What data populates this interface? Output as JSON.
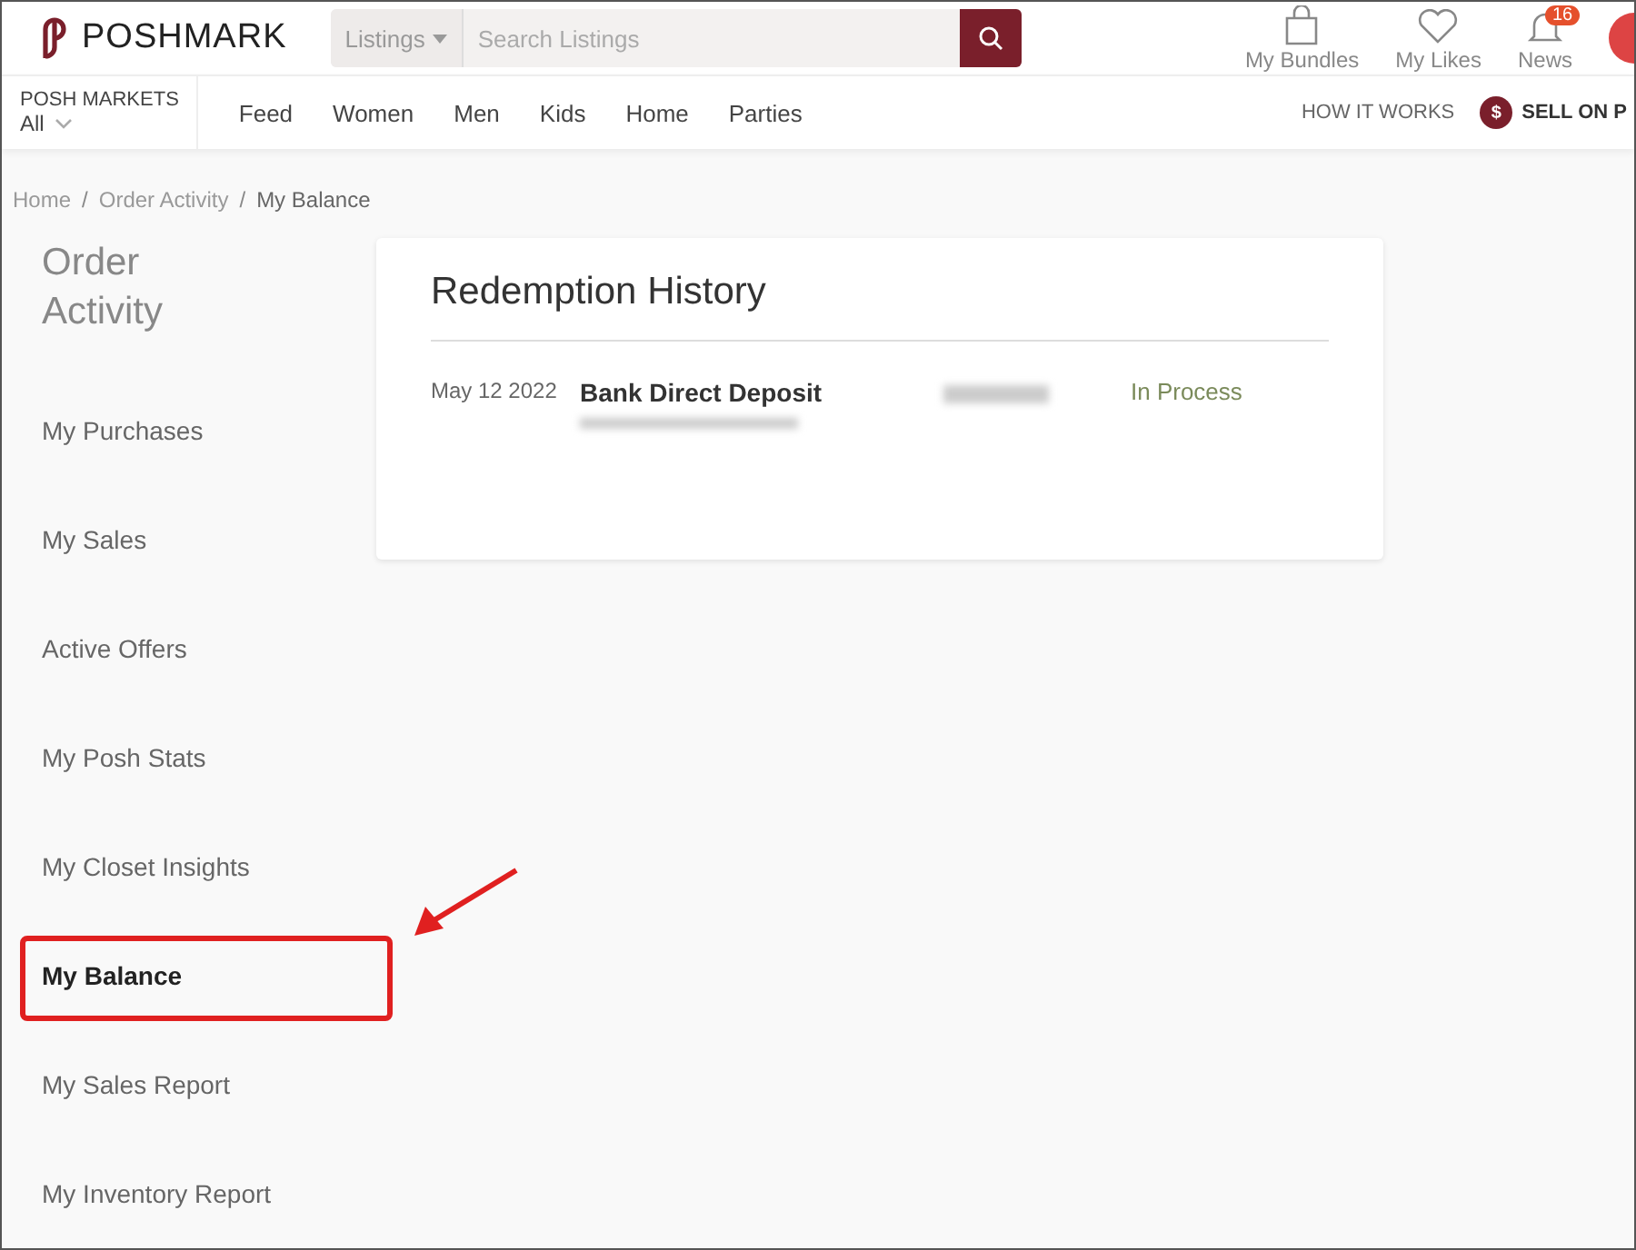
{
  "header": {
    "logo": "POSHMARK",
    "search_scope": "Listings",
    "search_placeholder": "Search Listings",
    "nav_icons": [
      {
        "kind": "bag",
        "label": "My Bundles"
      },
      {
        "kind": "heart",
        "label": "My Likes"
      },
      {
        "kind": "bell",
        "label": "News",
        "badge": "16"
      }
    ]
  },
  "market": {
    "title": "POSH MARKETS",
    "value": "All"
  },
  "categories": [
    "Feed",
    "Women",
    "Men",
    "Kids",
    "Home",
    "Parties"
  ],
  "how_it_works": "HOW IT WORKS",
  "sell_icon": "$",
  "sell": "SELL ON P",
  "breadcrumb_separator": "/",
  "breadcrumb": [
    "Home",
    "Order Activity",
    "My Balance"
  ],
  "sidebar": {
    "title": "Order Activity",
    "items": [
      {
        "label": "My Purchases",
        "selected": false
      },
      {
        "label": "My Sales",
        "selected": false
      },
      {
        "label": "Active Offers",
        "selected": false
      },
      {
        "label": "My Posh Stats",
        "selected": false
      },
      {
        "label": "My Closet Insights",
        "selected": false
      },
      {
        "label": "My Balance",
        "selected": true
      },
      {
        "label": "My Sales Report",
        "selected": false
      },
      {
        "label": "My Inventory Report",
        "selected": false
      }
    ]
  },
  "card": {
    "title": "Redemption History",
    "rows": [
      {
        "date": "May 12 2022",
        "method": "Bank Direct Deposit",
        "status": "In Process"
      }
    ]
  }
}
